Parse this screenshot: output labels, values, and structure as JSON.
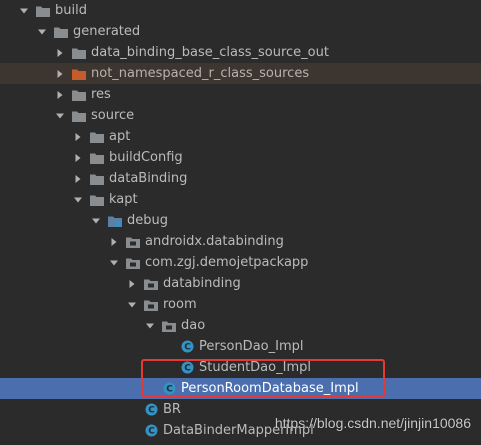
{
  "tree": {
    "rows": [
      {
        "label": "build",
        "indent": 0,
        "arrow": "down",
        "icon": "folder-icon"
      },
      {
        "label": "generated",
        "indent": 1,
        "arrow": "down",
        "icon": "folder-icon"
      },
      {
        "label": "data_binding_base_class_source_out",
        "indent": 2,
        "arrow": "right",
        "icon": "folder-icon"
      },
      {
        "label": "not_namespaced_r_class_sources",
        "indent": 2,
        "arrow": "right",
        "icon": "orange-folder-icon",
        "excluded": true
      },
      {
        "label": "res",
        "indent": 2,
        "arrow": "right",
        "icon": "folder-icon"
      },
      {
        "label": "source",
        "indent": 2,
        "arrow": "down",
        "icon": "folder-icon"
      },
      {
        "label": "apt",
        "indent": 3,
        "arrow": "right",
        "icon": "folder-icon"
      },
      {
        "label": "buildConfig",
        "indent": 3,
        "arrow": "right",
        "icon": "folder-icon"
      },
      {
        "label": "dataBinding",
        "indent": 3,
        "arrow": "right",
        "icon": "folder-icon"
      },
      {
        "label": "kapt",
        "indent": 3,
        "arrow": "down",
        "icon": "folder-icon"
      },
      {
        "label": "debug",
        "indent": 4,
        "arrow": "down",
        "icon": "source-folder-icon"
      },
      {
        "label": "androidx.databinding",
        "indent": 5,
        "arrow": "right",
        "icon": "package-icon"
      },
      {
        "label": "com.zgj.demojetpackapp",
        "indent": 5,
        "arrow": "down",
        "icon": "package-icon"
      },
      {
        "label": "databinding",
        "indent": 6,
        "arrow": "right",
        "icon": "package-icon"
      },
      {
        "label": "room",
        "indent": 6,
        "arrow": "down",
        "icon": "package-icon"
      },
      {
        "label": "dao",
        "indent": 7,
        "arrow": "down",
        "icon": "package-icon"
      },
      {
        "label": "PersonDao_Impl",
        "indent": 8,
        "arrow": "none",
        "icon": "class-icon"
      },
      {
        "label": "StudentDao_Impl",
        "indent": 8,
        "arrow": "none",
        "icon": "class-icon"
      },
      {
        "label": "PersonRoomDatabase_Impl",
        "indent": 7,
        "arrow": "none",
        "icon": "class-icon",
        "selected": true
      },
      {
        "label": "BR",
        "indent": 6,
        "arrow": "none",
        "icon": "class-icon"
      },
      {
        "label": "DataBinderMapperImpl",
        "indent": 6,
        "arrow": "none",
        "icon": "class-icon"
      }
    ]
  },
  "watermark": "https://blog.csdn.net/jinjin10086",
  "colors": {
    "background": "#2b2b2b",
    "selection": "#4b6eaf",
    "highlight_box": "#e53935",
    "folder": "#8a8d8f",
    "orange_folder": "#c65c2b",
    "class_icon": "#3592c4"
  }
}
